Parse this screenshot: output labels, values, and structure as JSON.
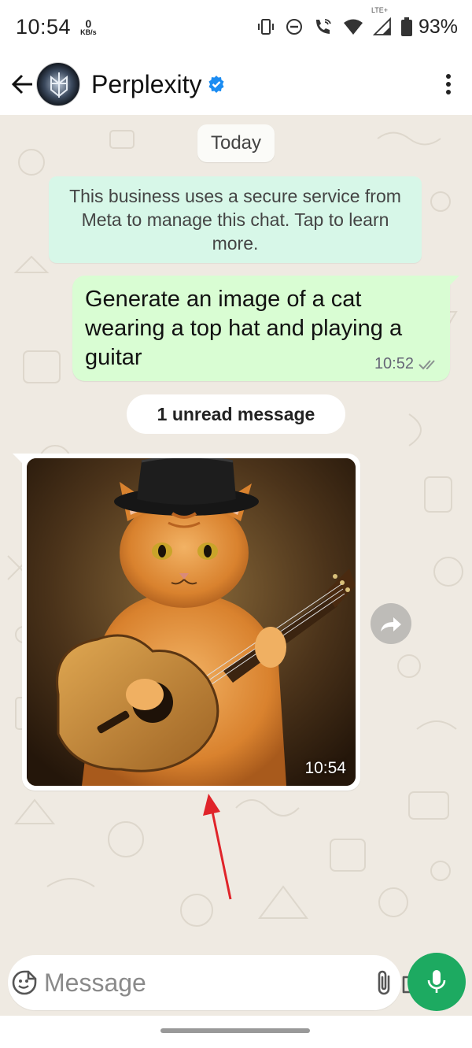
{
  "status_bar": {
    "time": "10:54",
    "net_speed_value": "0",
    "net_speed_unit": "KB/s",
    "network_type": "LTE+",
    "battery": "93%"
  },
  "header": {
    "contact_name": "Perplexity",
    "verified": true
  },
  "chat": {
    "date_label": "Today",
    "business_notice": "This business uses a secure service from Meta to manage this chat. Tap to learn more.",
    "outgoing_message": {
      "text": "Generate an image of  a cat wearing a top hat and playing a guitar",
      "time": "10:52",
      "status": "read"
    },
    "unread_label": "1 unread message",
    "incoming_image": {
      "time": "10:54"
    }
  },
  "composer": {
    "placeholder": "Message"
  },
  "icons": {
    "back": "arrow-left-icon",
    "menu": "kebab-menu-icon",
    "verified": "verified-badge-icon",
    "emoji": "sticker-icon",
    "attach": "paperclip-icon",
    "camera": "camera-icon",
    "mic": "microphone-icon",
    "forward": "forward-icon"
  },
  "colors": {
    "chat_background": "#efeae2",
    "outgoing_bubble": "#d9fdd3",
    "notice_bubble": "#d7f7e8",
    "mic_button": "#1daa61",
    "verified_badge": "#1b8cf2",
    "annotation_arrow": "#e0242a"
  }
}
